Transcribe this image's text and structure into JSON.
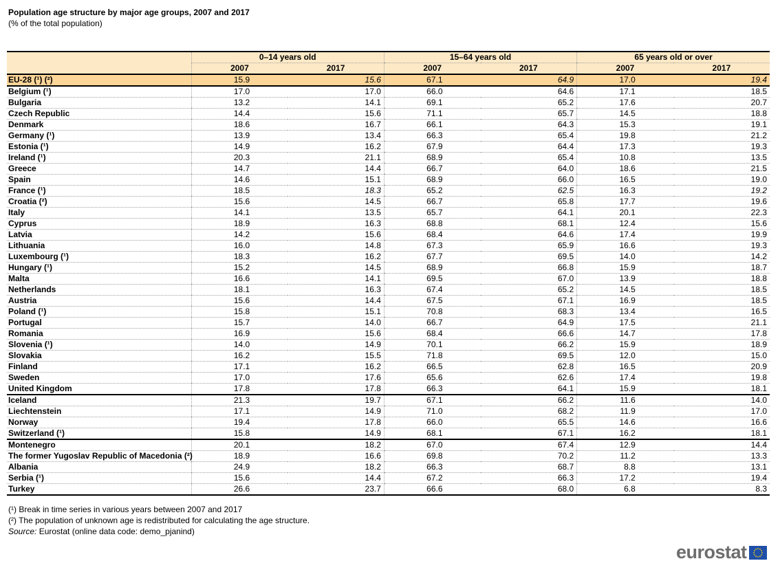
{
  "title": "Population age structure by major age groups, 2007 and 2017",
  "subtitle": "(% of the total population)",
  "table": {
    "groups": [
      "0–14 years old",
      "15–64 years old",
      "65 years old or over"
    ],
    "years": [
      "2007",
      "2017",
      "2007",
      "2017",
      "2007",
      "2017"
    ],
    "rows": [
      {
        "label": "EU-28 (¹) (²)",
        "values": [
          "15.9",
          "15.6",
          "67.1",
          "64.9",
          "17.0",
          "19.4"
        ],
        "italic": [
          false,
          true,
          false,
          true,
          false,
          true
        ],
        "highlight": true
      },
      {
        "label": "Belgium (¹)",
        "values": [
          "17.0",
          "17.0",
          "66.0",
          "64.6",
          "17.1",
          "18.5"
        ]
      },
      {
        "label": "Bulgaria",
        "values": [
          "13.2",
          "14.1",
          "69.1",
          "65.2",
          "17.6",
          "20.7"
        ]
      },
      {
        "label": "Czech Republic",
        "values": [
          "14.4",
          "15.6",
          "71.1",
          "65.7",
          "14.5",
          "18.8"
        ]
      },
      {
        "label": "Denmark",
        "values": [
          "18.6",
          "16.7",
          "66.1",
          "64.3",
          "15.3",
          "19.1"
        ]
      },
      {
        "label": "Germany (¹)",
        "values": [
          "13.9",
          "13.4",
          "66.3",
          "65.4",
          "19.8",
          "21.2"
        ]
      },
      {
        "label": "Estonia (¹)",
        "values": [
          "14.9",
          "16.2",
          "67.9",
          "64.4",
          "17.3",
          "19.3"
        ]
      },
      {
        "label": "Ireland (¹)",
        "values": [
          "20.3",
          "21.1",
          "68.9",
          "65.4",
          "10.8",
          "13.5"
        ]
      },
      {
        "label": "Greece",
        "values": [
          "14.7",
          "14.4",
          "66.7",
          "64.0",
          "18.6",
          "21.5"
        ]
      },
      {
        "label": "Spain",
        "values": [
          "14.6",
          "15.1",
          "68.9",
          "66.0",
          "16.5",
          "19.0"
        ]
      },
      {
        "label": "France (¹)",
        "values": [
          "18.5",
          "18.3",
          "65.2",
          "62.5",
          "16.3",
          "19.2"
        ],
        "italic": [
          false,
          true,
          false,
          true,
          false,
          true
        ]
      },
      {
        "label": "Croatia (²)",
        "values": [
          "15.6",
          "14.5",
          "66.7",
          "65.8",
          "17.7",
          "19.6"
        ]
      },
      {
        "label": "Italy",
        "values": [
          "14.1",
          "13.5",
          "65.7",
          "64.1",
          "20.1",
          "22.3"
        ]
      },
      {
        "label": "Cyprus",
        "values": [
          "18.9",
          "16.3",
          "68.8",
          "68.1",
          "12.4",
          "15.6"
        ]
      },
      {
        "label": "Latvia",
        "values": [
          "14.2",
          "15.6",
          "68.4",
          "64.6",
          "17.4",
          "19.9"
        ]
      },
      {
        "label": "Lithuania",
        "values": [
          "16.0",
          "14.8",
          "67.3",
          "65.9",
          "16.6",
          "19.3"
        ]
      },
      {
        "label": "Luxembourg (¹)",
        "values": [
          "18.3",
          "16.2",
          "67.7",
          "69.5",
          "14.0",
          "14.2"
        ]
      },
      {
        "label": "Hungary (¹)",
        "values": [
          "15.2",
          "14.5",
          "68.9",
          "66.8",
          "15.9",
          "18.7"
        ]
      },
      {
        "label": "Malta",
        "values": [
          "16.6",
          "14.1",
          "69.5",
          "67.0",
          "13.9",
          "18.8"
        ]
      },
      {
        "label": "Netherlands",
        "values": [
          "18.1",
          "16.3",
          "67.4",
          "65.2",
          "14.5",
          "18.5"
        ]
      },
      {
        "label": "Austria",
        "values": [
          "15.6",
          "14.4",
          "67.5",
          "67.1",
          "16.9",
          "18.5"
        ]
      },
      {
        "label": "Poland (¹)",
        "values": [
          "15.8",
          "15.1",
          "70.8",
          "68.3",
          "13.4",
          "16.5"
        ]
      },
      {
        "label": "Portugal",
        "values": [
          "15.7",
          "14.0",
          "66.7",
          "64.9",
          "17.5",
          "21.1"
        ]
      },
      {
        "label": "Romania",
        "values": [
          "16.9",
          "15.6",
          "68.4",
          "66.6",
          "14.7",
          "17.8"
        ]
      },
      {
        "label": "Slovenia (¹)",
        "values": [
          "14.0",
          "14.9",
          "70.1",
          "66.2",
          "15.9",
          "18.9"
        ]
      },
      {
        "label": "Slovakia",
        "values": [
          "16.2",
          "15.5",
          "71.8",
          "69.5",
          "12.0",
          "15.0"
        ]
      },
      {
        "label": "Finland",
        "values": [
          "17.1",
          "16.2",
          "66.5",
          "62.8",
          "16.5",
          "20.9"
        ]
      },
      {
        "label": "Sweden",
        "values": [
          "17.0",
          "17.6",
          "65.6",
          "62.6",
          "17.4",
          "19.8"
        ]
      },
      {
        "label": "United Kingdom",
        "values": [
          "17.8",
          "17.8",
          "66.3",
          "64.1",
          "15.9",
          "18.1"
        ],
        "group_end": true
      },
      {
        "label": "Iceland",
        "values": [
          "21.3",
          "19.7",
          "67.1",
          "66.2",
          "11.6",
          "14.0"
        ]
      },
      {
        "label": "Liechtenstein",
        "values": [
          "17.1",
          "14.9",
          "71.0",
          "68.2",
          "11.9",
          "17.0"
        ]
      },
      {
        "label": "Norway",
        "values": [
          "19.4",
          "17.8",
          "66.0",
          "65.5",
          "14.6",
          "16.6"
        ]
      },
      {
        "label": "Switzerland (¹)",
        "values": [
          "15.8",
          "14.9",
          "68.1",
          "67.1",
          "16.2",
          "18.1"
        ],
        "group_end": true
      },
      {
        "label": "Montenegro",
        "values": [
          "20.1",
          "18.2",
          "67.0",
          "67.4",
          "12.9",
          "14.4"
        ]
      },
      {
        "label": "The former Yugoslav Republic of Macedonia (²)",
        "values": [
          "18.9",
          "16.6",
          "69.8",
          "70.2",
          "11.2",
          "13.3"
        ]
      },
      {
        "label": "Albania",
        "values": [
          "24.9",
          "18.2",
          "66.3",
          "68.7",
          "8.8",
          "13.1"
        ]
      },
      {
        "label": "Serbia (¹)",
        "values": [
          "15.6",
          "14.4",
          "67.2",
          "66.3",
          "17.2",
          "19.4"
        ]
      },
      {
        "label": "Turkey",
        "values": [
          "26.6",
          "23.7",
          "66.6",
          "68.0",
          "6.8",
          "8.3"
        ],
        "last": true
      }
    ]
  },
  "notes": {
    "note1": "(¹) Break in time series in various years between 2007 and 2017",
    "note2": "(²) The population of unknown age is redistributed for calculating the age structure.",
    "source_label": "Source:",
    "source_text": " Eurostat (online data code: demo_pjanind)"
  },
  "logo": {
    "text": "eurostat",
    "icon": "eu-flag-icon",
    "flag_color": "#1f4fa8",
    "star_color": "#ffdd00"
  },
  "colors": {
    "header_bg": "#fde9c6",
    "highlight_row_bg": "#fcd598"
  }
}
